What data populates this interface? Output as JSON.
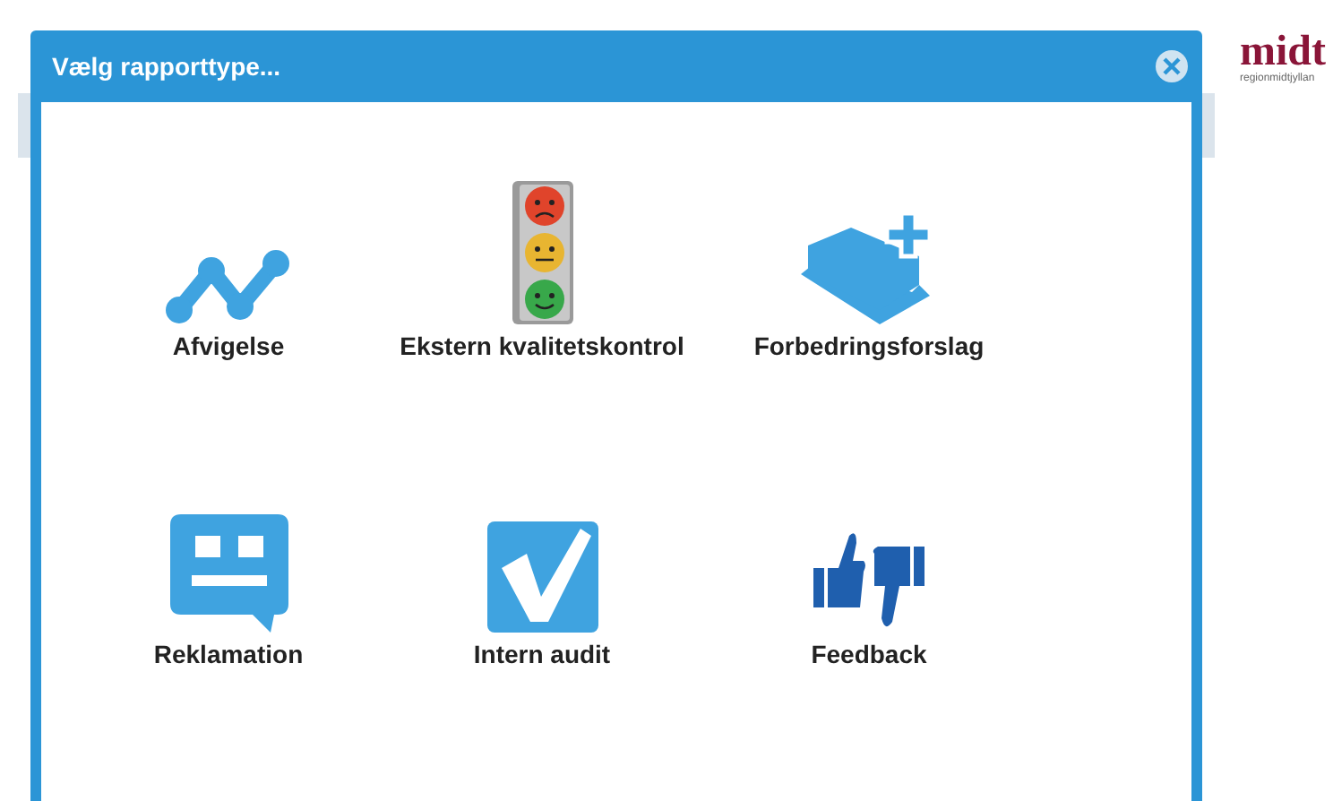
{
  "logo": {
    "mark": "midt",
    "subtitle": "regionmidtjyllan"
  },
  "dialog": {
    "title": "Vælg rapporttype...",
    "options": [
      {
        "kind": "chart",
        "label": "Afvigelse"
      },
      {
        "kind": "traffic-light",
        "label": "Ekstern kvalitetskontrol"
      },
      {
        "kind": "layers",
        "label": "Forbedringsforslag"
      },
      {
        "kind": "chat",
        "label": "Reklamation"
      },
      {
        "kind": "check",
        "label": "Intern audit"
      },
      {
        "kind": "thumbs",
        "label": "Feedback"
      }
    ]
  }
}
